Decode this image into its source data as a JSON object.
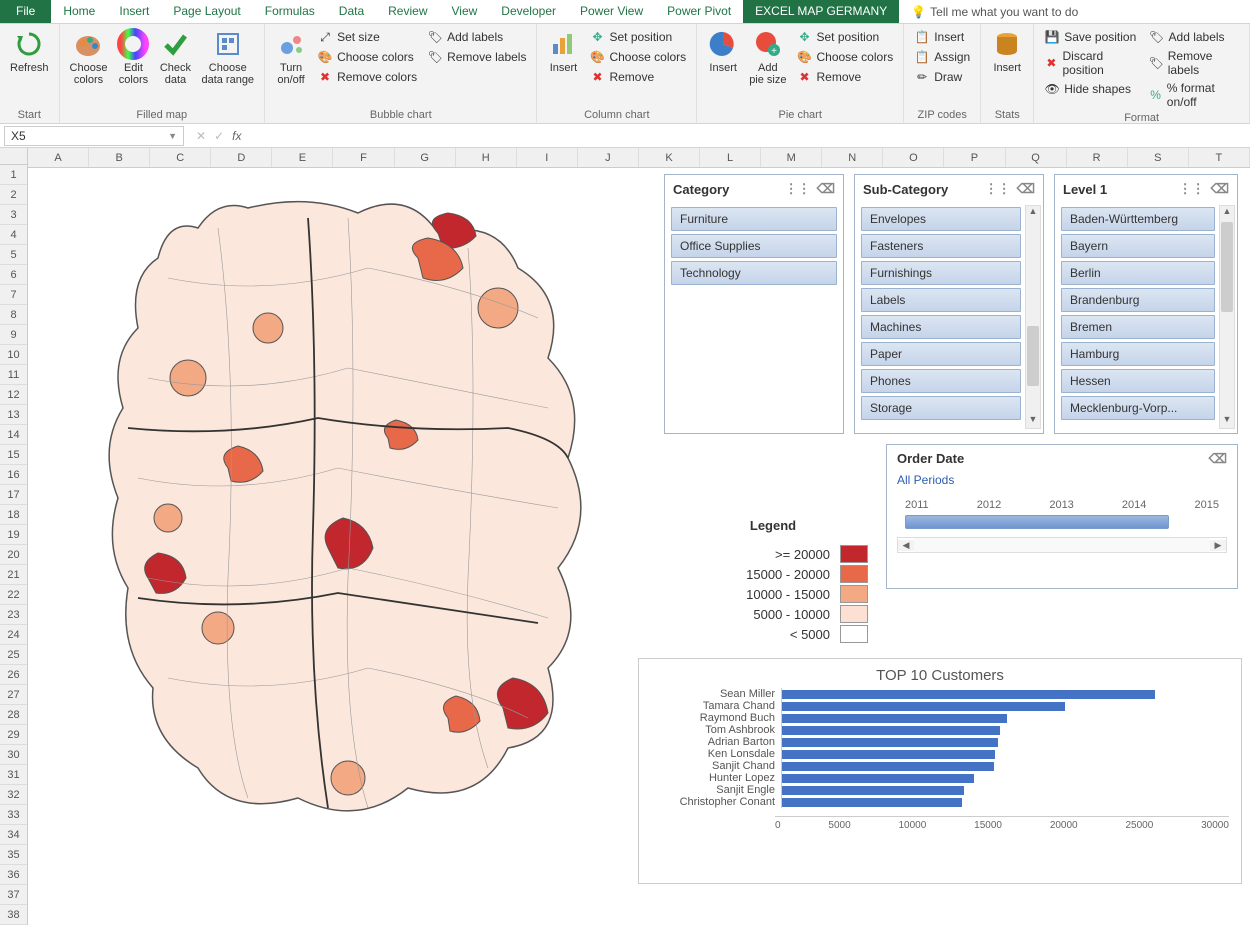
{
  "tabs": {
    "file": "File",
    "items": [
      "Home",
      "Insert",
      "Page Layout",
      "Formulas",
      "Data",
      "Review",
      "View",
      "Developer",
      "Power View",
      "Power Pivot"
    ],
    "active": "EXCEL MAP GERMANY",
    "tell": "Tell me what you want to do"
  },
  "ribbon": {
    "start": {
      "label": "Start",
      "refresh": "Refresh"
    },
    "filled": {
      "label": "Filled map",
      "choose_colors": "Choose\ncolors",
      "edit_colors": "Edit\ncolors",
      "check_data": "Check\ndata",
      "choose_range": "Choose\ndata range"
    },
    "bubble": {
      "label": "Bubble chart",
      "turn": "Turn\non/off",
      "set_size": "Set size",
      "choose_colors": "Choose colors",
      "remove_colors": "Remove colors",
      "add_labels": "Add labels",
      "remove_labels": "Remove labels"
    },
    "column": {
      "label": "Column chart",
      "insert": "Insert",
      "set_position": "Set position",
      "choose_colors": "Choose colors",
      "remove": "Remove"
    },
    "pie": {
      "label": "Pie chart",
      "insert": "Insert",
      "add_pie": "Add\npie size",
      "set_position": "Set position",
      "choose_colors": "Choose colors",
      "remove": "Remove"
    },
    "zip": {
      "label": "ZIP codes",
      "insert": "Insert",
      "assign": "Assign",
      "draw": "Draw"
    },
    "stats": {
      "label": "Stats",
      "insert": "Insert"
    },
    "format": {
      "label": "Format",
      "save_pos": "Save position",
      "discard_pos": "Discard position",
      "hide_shapes": "Hide shapes",
      "add_labels": "Add labels",
      "remove_labels": "Remove labels",
      "pct_format": "% format on/off"
    }
  },
  "fbar": {
    "cell": "X5",
    "formula": ""
  },
  "columns": [
    "A",
    "B",
    "C",
    "D",
    "E",
    "F",
    "G",
    "H",
    "I",
    "J",
    "K",
    "L",
    "M",
    "N",
    "O",
    "P",
    "Q",
    "R",
    "S",
    "T"
  ],
  "legend": {
    "title": "Legend",
    "rows": [
      {
        "label": ">=   20000",
        "color": "#c1272d"
      },
      {
        "label": "15000 - 20000",
        "color": "#e8694a"
      },
      {
        "label": "10000 - 15000",
        "color": "#f2a984"
      },
      {
        "label": "5000 - 10000",
        "color": "#fbe0d3"
      },
      {
        "label": "<    5000",
        "color": "#ffffff"
      }
    ]
  },
  "slicers": {
    "category": {
      "title": "Category",
      "items": [
        "Furniture",
        "Office Supplies",
        "Technology"
      ]
    },
    "subcategory": {
      "title": "Sub-Category",
      "items": [
        "Envelopes",
        "Fasteners",
        "Furnishings",
        "Labels",
        "Machines",
        "Paper",
        "Phones",
        "Storage"
      ]
    },
    "level1": {
      "title": "Level 1",
      "items": [
        "Baden-Württemberg",
        "Bayern",
        "Berlin",
        "Brandenburg",
        "Bremen",
        "Hamburg",
        "Hessen",
        "Mecklenburg-Vorp..."
      ]
    }
  },
  "timeline": {
    "title": "Order Date",
    "period": "All Periods",
    "years": [
      "2011",
      "2012",
      "2013",
      "2014",
      "2015"
    ]
  },
  "chart_data": {
    "type": "bar",
    "title": "TOP 10 Customers",
    "categories": [
      "Sean Miller",
      "Tamara Chand",
      "Raymond Buch",
      "Tom Ashbrook",
      "Adrian Barton",
      "Ken Lonsdale",
      "Sanjit Chand",
      "Hunter Lopez",
      "Sanjit Engle",
      "Christopher Conant"
    ],
    "values": [
      25000,
      19000,
      15100,
      14600,
      14500,
      14300,
      14200,
      12900,
      12200,
      12100
    ],
    "xlabel": "",
    "ylabel": "",
    "xticks": [
      0,
      5000,
      10000,
      15000,
      20000,
      25000,
      30000
    ],
    "xlim": [
      0,
      30000
    ]
  }
}
